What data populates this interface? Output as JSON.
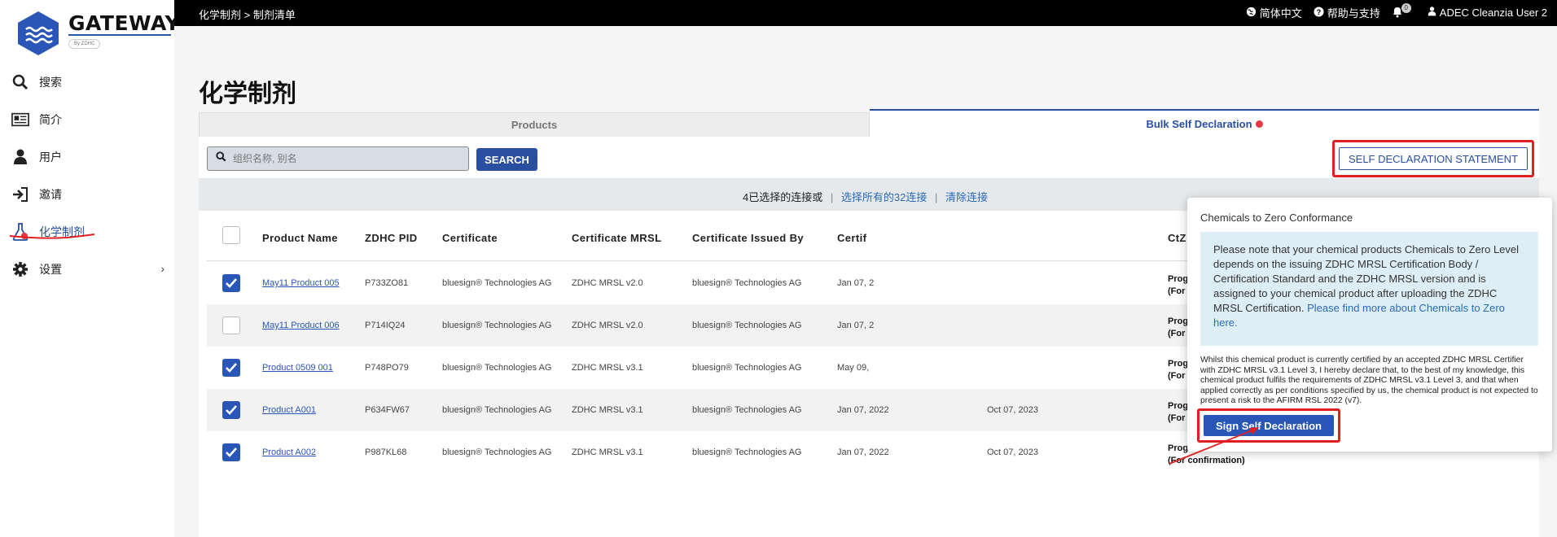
{
  "logo": {
    "name": "GATEWAY",
    "tag": "By ZDHC"
  },
  "nav": [
    {
      "label": "搜索",
      "icon": "search-icon"
    },
    {
      "label": "简介",
      "icon": "profile-card-icon"
    },
    {
      "label": "用户",
      "icon": "user-icon"
    },
    {
      "label": "邀请",
      "icon": "sign-in-icon"
    },
    {
      "label": "化学制剂",
      "icon": "flask-icon"
    },
    {
      "label": "设置",
      "icon": "gear-icon"
    }
  ],
  "topbar": {
    "breadcrumb": "化学制剂 > 制剂清单",
    "language": "简体中文",
    "help": "帮助与支持",
    "notification_count": "0",
    "user": "ADEC Cleanzia User 2"
  },
  "page": {
    "title": "化学制剂",
    "tabs": [
      {
        "label": "Products"
      },
      {
        "label": "Bulk Self Declaration"
      }
    ],
    "search_placeholder": "组织名称, 别名",
    "search_button": "SEARCH",
    "sds_button": "SELF DECLARATION STATEMENT",
    "selection": {
      "selected_text": "4已选择的连接或",
      "select_all": "选择所有的32连接",
      "clear": "清除连接"
    }
  },
  "table": {
    "headers": [
      "Product Name",
      "ZDHC PID",
      "Certificate",
      "Certificate MRSL",
      "Certificate Issued By",
      "Certif",
      "CtZ Conformance"
    ],
    "rows": [
      {
        "checked": true,
        "name": "May11 Product 005",
        "pid": "P733ZO81",
        "cert": "bluesign® Technologies AG",
        "mrsl": "ZDHC MRSL v2.0",
        "issued_by": "bluesign® Technologies AG",
        "date1": "Jan 07, 2",
        "date2": "",
        "ctz1": "Progressive",
        "ctz2": "(For confirmation)"
      },
      {
        "checked": false,
        "name": "May11 Product 006",
        "pid": "P714IQ24",
        "cert": "bluesign® Technologies AG",
        "mrsl": "ZDHC MRSL v2.0",
        "issued_by": "bluesign® Technologies AG",
        "date1": "Jan 07, 2",
        "date2": "",
        "ctz1": "Progressive",
        "ctz2": "(For confirmation)"
      },
      {
        "checked": true,
        "name": "Product 0509 001",
        "pid": "P748PO79",
        "cert": "bluesign® Technologies AG",
        "mrsl": "ZDHC MRSL v3.1",
        "issued_by": "bluesign® Technologies AG",
        "date1": "May 09,",
        "date2": "",
        "ctz1": "Progressive",
        "ctz2": "(For confirmation)"
      },
      {
        "checked": true,
        "name": "Product A001",
        "pid": "P634FW67",
        "cert": "bluesign® Technologies AG",
        "mrsl": "ZDHC MRSL v3.1",
        "issued_by": "bluesign® Technologies AG",
        "date1": "Jan 07, 2022",
        "date2": "Oct 07, 2023",
        "ctz1": "Progressive",
        "ctz2": "(For confirmation)"
      },
      {
        "checked": true,
        "name": "Product A002",
        "pid": "P987KL68",
        "cert": "bluesign® Technologies AG",
        "mrsl": "ZDHC MRSL v3.1",
        "issued_by": "bluesign® Technologies AG",
        "date1": "Jan 07, 2022",
        "date2": "Oct 07, 2023",
        "ctz1": "Progressive",
        "ctz2": "(For confirmation)"
      }
    ]
  },
  "popup": {
    "title": "Chemicals to Zero Conformance",
    "info": "Please note that your chemical products  Chemicals to Zero Level depends on the issuing ZDHC MRSL Certification Body / Certification Standard and the ZDHC MRSL version and is assigned to your chemical product after uploading the ZDHC MRSL Certification.",
    "info_link": "Please find more about Chemicals to Zero here.",
    "declaration": "Whilst this chemical product is currently certified by an accepted ZDHC MRSL Certifier with ZDHC MRSL v3.1 Level 3, I hereby declare that, to the best of my knowledge, this chemical product fulfils the requirements of ZDHC MRSL v3.1 Level 3, and that when applied correctly as per conditions specified by us, the chemical product is not expected to present a risk to the AFIRM RSL 2022 (v7).",
    "button": "Sign Self Declaration"
  },
  "colors": {
    "accent": "#2a4ea0",
    "highlight": "#e02020",
    "topbar": "#000000"
  }
}
